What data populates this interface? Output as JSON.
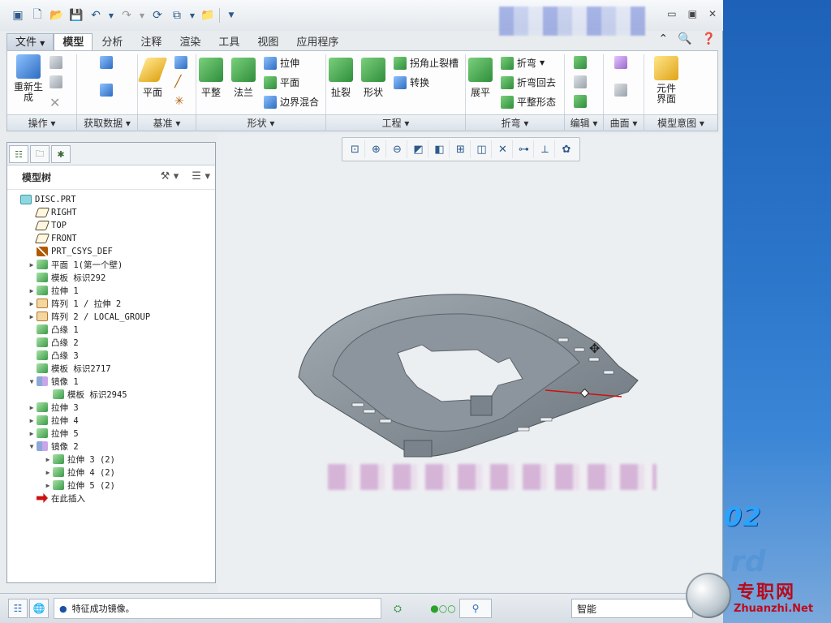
{
  "ribbon": {
    "tabs": [
      "文件",
      "模型",
      "分析",
      "注释",
      "渲染",
      "工具",
      "视图",
      "应用程序"
    ],
    "active_tab": "模型",
    "buttons": {
      "regen": "重新生成",
      "plane": "平面",
      "flat": "平整",
      "flange": "法兰",
      "extrude": "拉伸",
      "flat_small": "平面",
      "blend": "边界混合",
      "rip": "扯裂",
      "form": "形状",
      "corner_relief": "拐角止裂槽",
      "convert": "转换",
      "unbend": "展平",
      "bend": "折弯",
      "bend_back": "折弯回去",
      "flatten": "平整形态",
      "component_interface": "元件界面"
    },
    "groups": [
      "操作",
      "获取数据",
      "基准",
      "形状",
      "工程",
      "折弯",
      "编辑",
      "曲面",
      "模型意图"
    ]
  },
  "model_tree": {
    "title": "模型树",
    "nodes": [
      {
        "label": "DISC.PRT",
        "icon": "part-icon",
        "level": 0,
        "expand": ""
      },
      {
        "label": "RIGHT",
        "icon": "datum-plane-icon",
        "level": 1,
        "expand": ""
      },
      {
        "label": "TOP",
        "icon": "datum-plane-icon",
        "level": 1,
        "expand": ""
      },
      {
        "label": "FRONT",
        "icon": "datum-plane-icon",
        "level": 1,
        "expand": ""
      },
      {
        "label": "PRT_CSYS_DEF",
        "icon": "csys-icon",
        "level": 1,
        "expand": ""
      },
      {
        "label": "平面 1(第一个壁)",
        "icon": "feature-icon",
        "level": 1,
        "expand": "▶"
      },
      {
        "label": "模板 标识292",
        "icon": "feature-icon",
        "level": 1,
        "expand": ""
      },
      {
        "label": "拉伸 1",
        "icon": "feature-icon",
        "level": 1,
        "expand": "▶"
      },
      {
        "label": "阵列 1 / 拉伸 2",
        "icon": "pattern-icon",
        "level": 1,
        "expand": "▶"
      },
      {
        "label": "阵列 2 / LOCAL_GROUP",
        "icon": "pattern-icon",
        "level": 1,
        "expand": "▶"
      },
      {
        "label": "凸缘 1",
        "icon": "feature-icon",
        "level": 1,
        "expand": ""
      },
      {
        "label": "凸缘 2",
        "icon": "feature-icon",
        "level": 1,
        "expand": ""
      },
      {
        "label": "凸缘 3",
        "icon": "feature-icon",
        "level": 1,
        "expand": ""
      },
      {
        "label": "模板 标识2717",
        "icon": "feature-icon",
        "level": 1,
        "expand": ""
      },
      {
        "label": "镜像 1",
        "icon": "mirror-icon",
        "level": 1,
        "expand": "▼"
      },
      {
        "label": "模板 标识2945",
        "icon": "feature-icon",
        "level": 2,
        "expand": ""
      },
      {
        "label": "拉伸 3",
        "icon": "feature-icon",
        "level": 1,
        "expand": "▶"
      },
      {
        "label": "拉伸 4",
        "icon": "feature-icon",
        "level": 1,
        "expand": "▶"
      },
      {
        "label": "拉伸 5",
        "icon": "feature-icon",
        "level": 1,
        "expand": "▶"
      },
      {
        "label": "镜像 2",
        "icon": "mirror-icon",
        "level": 1,
        "expand": "▼"
      },
      {
        "label": "拉伸 3 (2)",
        "icon": "feature-icon",
        "level": 2,
        "expand": "▶"
      },
      {
        "label": "拉伸 4 (2)",
        "icon": "feature-icon",
        "level": 2,
        "expand": "▶"
      },
      {
        "label": "拉伸 5 (2)",
        "icon": "feature-icon",
        "level": 2,
        "expand": "▶"
      },
      {
        "label": "在此插入",
        "icon": "insert-here-icon",
        "level": 1,
        "expand": ""
      }
    ]
  },
  "status": {
    "message": "特征成功镜像。",
    "filter_value": "智能"
  },
  "desktop": {
    "number_text": "02"
  },
  "watermark": {
    "cn": "专职网",
    "en": "Zhuanzhi.Net"
  }
}
